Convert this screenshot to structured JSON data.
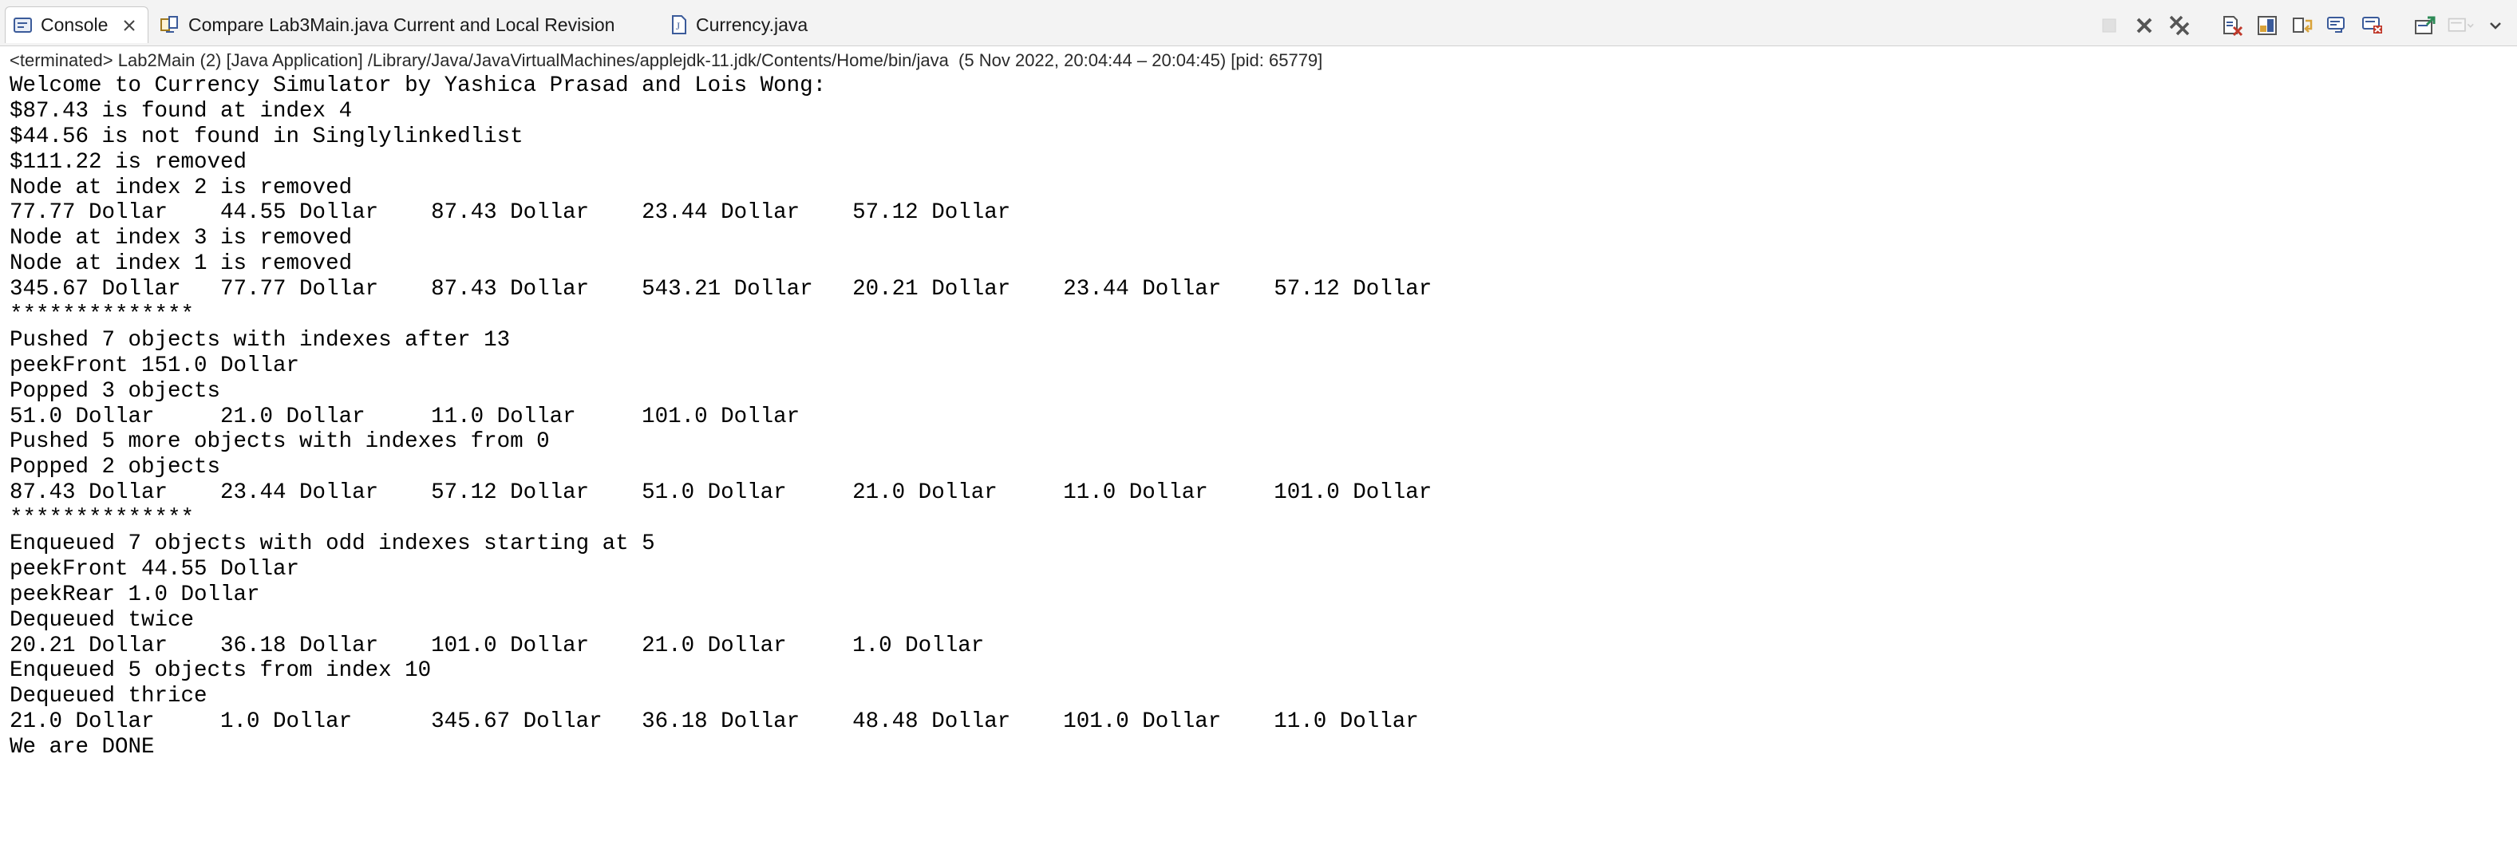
{
  "tabs": [
    {
      "label": "Console",
      "icon": "console-icon",
      "active": true
    },
    {
      "label": "Compare Lab3Main.java Current and Local Revision",
      "icon": "compare-icon",
      "active": false
    },
    {
      "label": "Currency.java",
      "icon": "java-file-icon",
      "active": false
    }
  ],
  "toolbar": {
    "icons": [
      "terminate-icon",
      "remove-launch-icon",
      "remove-all-terminated-icon",
      "clear-console-icon",
      "scroll-lock-icon",
      "word-wrap-icon",
      "show-on-output-icon",
      "show-on-error-icon",
      "pin-console-icon",
      "display-console-icon",
      "view-menu-icon"
    ]
  },
  "status": {
    "text": "<terminated> Lab2Main (2) [Java Application] /Library/Java/JavaVirtualMachines/applejdk-11.jdk/Contents/Home/bin/java  (5 Nov 2022, 20:04:44 – 20:04:45) [pid: 65779]"
  },
  "console": {
    "lines": [
      "Welcome to Currency Simulator by Yashica Prasad and Lois Wong:",
      "$87.43 is found at index 4",
      "$44.56 is not found in Singlylinkedlist",
      "$111.22 is removed",
      "Node at index 2 is removed",
      "77.77 Dollar    44.55 Dollar    87.43 Dollar    23.44 Dollar    57.12 Dollar",
      "Node at index 3 is removed",
      "Node at index 1 is removed",
      "345.67 Dollar   77.77 Dollar    87.43 Dollar    543.21 Dollar   20.21 Dollar    23.44 Dollar    57.12 Dollar",
      "**************",
      "Pushed 7 objects with indexes after 13",
      "peekFront 151.0 Dollar",
      "Popped 3 objects",
      "51.0 Dollar     21.0 Dollar     11.0 Dollar     101.0 Dollar",
      "Pushed 5 more objects with indexes from 0",
      "Popped 2 objects",
      "87.43 Dollar    23.44 Dollar    57.12 Dollar    51.0 Dollar     21.0 Dollar     11.0 Dollar     101.0 Dollar",
      "**************",
      "Enqueued 7 objects with odd indexes starting at 5",
      "peekFront 44.55 Dollar",
      "peekRear 1.0 Dollar",
      "Dequeued twice",
      "20.21 Dollar    36.18 Dollar    101.0 Dollar    21.0 Dollar     1.0 Dollar",
      "Enqueued 5 objects from index 10",
      "Dequeued thrice",
      "21.0 Dollar     1.0 Dollar      345.67 Dollar   36.18 Dollar    48.48 Dollar    101.0 Dollar    11.0 Dollar",
      "We are DONE"
    ]
  }
}
